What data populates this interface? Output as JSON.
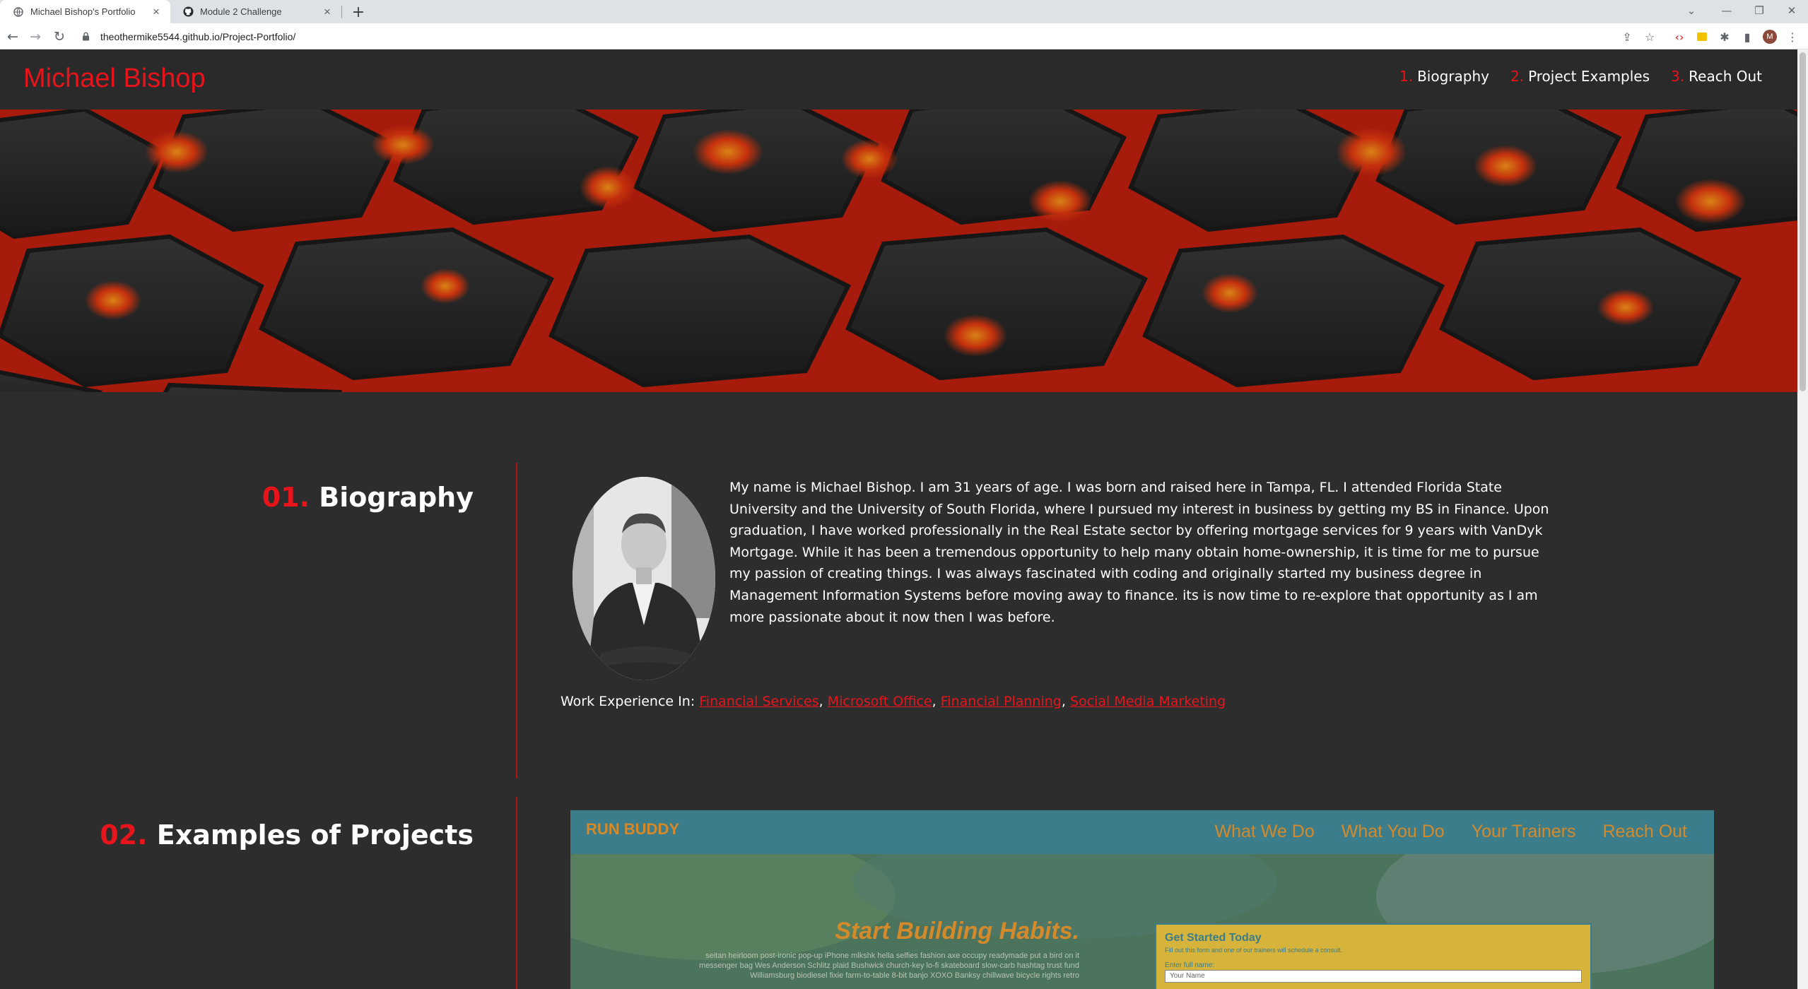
{
  "browser": {
    "tabs": [
      {
        "title": "Michael Bishop's Portfolio",
        "active": true
      },
      {
        "title": "Module 2 Challenge",
        "active": false
      }
    ],
    "url": "theothermike5544.github.io/Project-Portfolio/",
    "profile_initial": "M"
  },
  "site": {
    "title": "Michael Bishop",
    "nav": [
      {
        "num": "1.",
        "label": "Biography"
      },
      {
        "num": "2.",
        "label": "Project Examples"
      },
      {
        "num": "3.",
        "label": "Reach Out"
      }
    ]
  },
  "biography": {
    "num": "01.",
    "heading": "Biography",
    "text": "My name is Michael Bishop. I am 31 years of age. I was born and raised here in Tampa, FL. I attended Florida State University and the University of South Florida, where I pursued my interest in business by getting my BS in Finance. Upon graduation, I have worked professionally in the Real Estate sector by offering mortgage services for 9 years with VanDyk Mortgage. While it has been a tremendous opportunity to help many obtain home-ownership, it is time for me to pursue my passion of creating things. I was always fascinated with coding and originally started my business degree in Management Information Systems before moving away to finance. its is now time to re-explore that opportunity as I am more passionate about it now then I was before.",
    "work_label": "Work Experience In:",
    "skills": [
      "Financial Services",
      "Microsoft Office",
      "Financial Planning",
      "Social Media Marketing"
    ]
  },
  "projects": {
    "num": "02.",
    "heading": "Examples of Projects",
    "preview": {
      "logo": "RUN BUDDY",
      "nav": [
        "What We Do",
        "What You Do",
        "Your Trainers",
        "Reach Out"
      ],
      "headline": "Start Building Habits.",
      "lorem": "seitan heirloom post-ironic pop-up iPhone mlkshk hella selfies fashion axe occupy readymade put a bird on it messenger bag Wes Anderson Schlitz plaid Bushwick church-key lo-fi skateboard slow-carb hashtag trust fund Williamsburg biodiesel fixie farm-to-table 8-bit banjo XOXO Banksy chillwave bicycle rights retro",
      "form_title": "Get Started Today",
      "form_sub": "Fill out this form and one of our trainers will schedule a consult.",
      "form_label": "Enter full name:",
      "form_placeholder": "Your Name"
    }
  },
  "colors": {
    "accent": "#e8141b",
    "background": "#2d2d2d",
    "runbuddy_teal": "#3b7d8a",
    "runbuddy_orange": "#d48a2a"
  }
}
